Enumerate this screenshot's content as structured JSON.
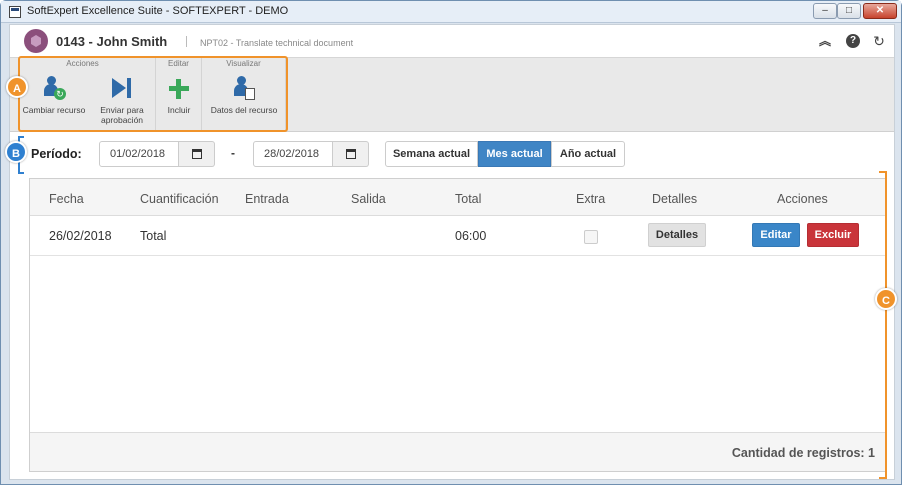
{
  "window": {
    "title": "SoftExpert Excellence Suite - SOFTEXPERT - DEMO",
    "controls": {
      "minimize": "–",
      "maximize": "□",
      "close": "✕"
    }
  },
  "header": {
    "title": "0143 - John Smith",
    "subtitle": "NPT02 - Translate technical document",
    "icons": [
      "collapse-icon",
      "help-icon",
      "refresh-icon"
    ]
  },
  "ribbon": {
    "groups": [
      {
        "label": "Acciones",
        "buttons": [
          {
            "label": "Cambiar recurso",
            "icon": "change-resource-icon"
          },
          {
            "label": "Enviar para aprobación",
            "icon": "send-approval-icon"
          }
        ]
      },
      {
        "label": "Editar",
        "buttons": [
          {
            "label": "Incluir",
            "icon": "plus-icon"
          }
        ]
      },
      {
        "label": "Visualizar",
        "buttons": [
          {
            "label": "Datos del recurso",
            "icon": "resource-data-icon"
          }
        ]
      }
    ]
  },
  "period": {
    "label": "Período:",
    "start": "01/02/2018",
    "end": "28/02/2018",
    "separator": "-",
    "options": [
      "Semana actual",
      "Mes actual",
      "Año actual"
    ],
    "selected": "Mes actual"
  },
  "table": {
    "columns": [
      "Fecha",
      "Cuantificación",
      "Entrada",
      "Salida",
      "Total",
      "Extra",
      "Detalles",
      "Acciones"
    ],
    "rows": [
      {
        "fecha": "26/02/2018",
        "cuantificacion": "Total",
        "entrada": "",
        "salida": "",
        "total": "06:00",
        "extra": false,
        "detalles_label": "Detalles",
        "edit_label": "Editar",
        "delete_label": "Excluir"
      }
    ],
    "footer": "Cantidad de registros: 1"
  },
  "callouts": {
    "a": "A",
    "b": "B",
    "c": "C"
  },
  "colors": {
    "accent_orange": "#f0932b",
    "accent_blue": "#2f80d0",
    "primary_button": "#3a86c8",
    "danger_button": "#c9343a"
  }
}
